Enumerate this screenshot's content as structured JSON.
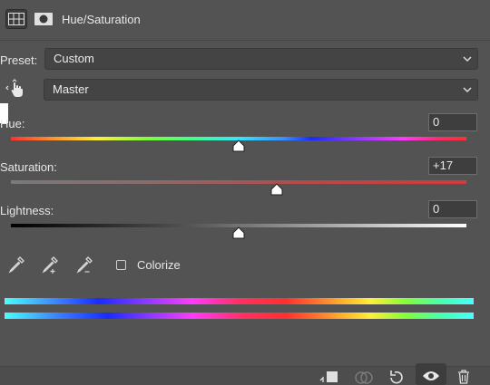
{
  "header": {
    "title": "Hue/Saturation",
    "icons": [
      "adjustment-layer-icon",
      "mask-icon"
    ]
  },
  "preset": {
    "label": "Preset:",
    "value": "Custom"
  },
  "channel": {
    "value": "Master",
    "tool_icon": "targeted-adjustment-hand-icon"
  },
  "hue": {
    "label": "Hue:",
    "value": "0",
    "position": 0.5
  },
  "saturation": {
    "label": "Saturation:",
    "value": "+17",
    "position": 0.585
  },
  "lightness": {
    "label": "Lightness:",
    "value": "0",
    "position": 0.5
  },
  "tools": {
    "icons": [
      "eyedropper-icon",
      "eyedropper-add-icon",
      "eyedropper-subtract-icon"
    ]
  },
  "colorize": {
    "label": "Colorize",
    "checked": false
  },
  "footer": {
    "icons": [
      "clip-to-layer-icon",
      "view-previous-state-icon",
      "reset-icon",
      "visibility-icon",
      "delete-icon"
    ]
  }
}
